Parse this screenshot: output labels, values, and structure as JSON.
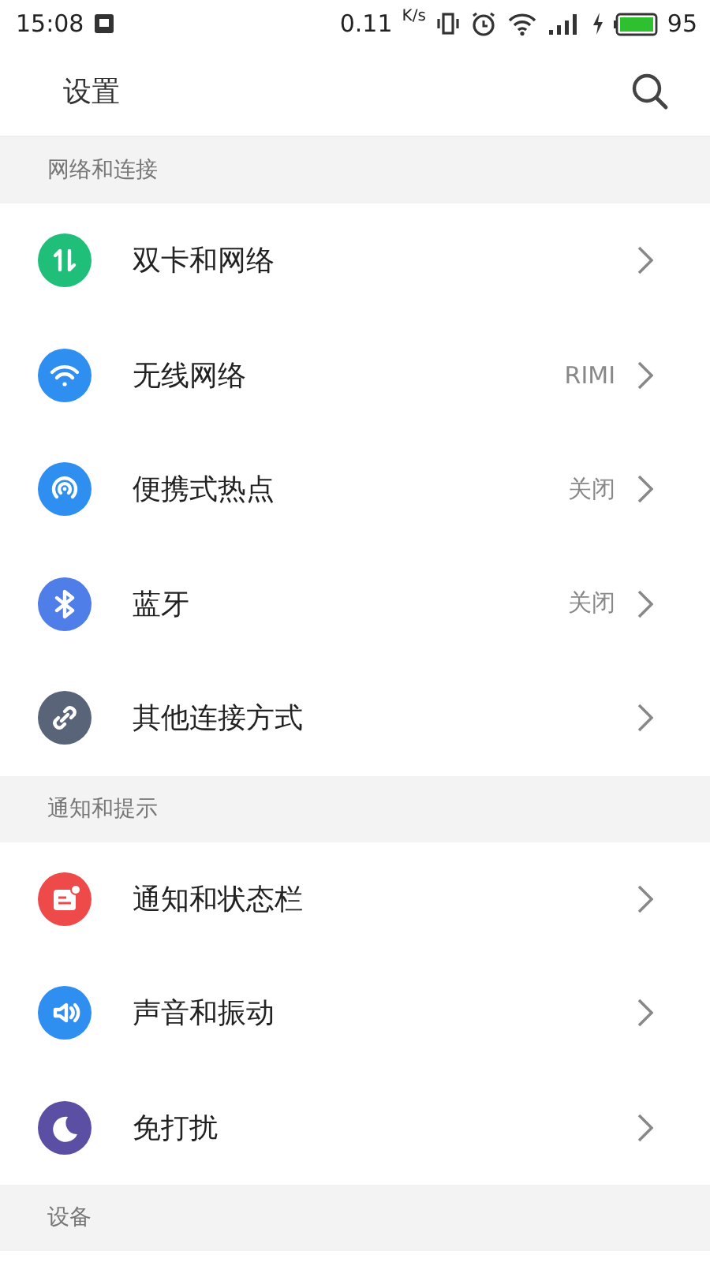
{
  "status_bar": {
    "time": "15:08",
    "speed": "0.11",
    "speed_unit": "K/s",
    "battery": "95"
  },
  "header": {
    "title": "设置"
  },
  "sections": [
    {
      "title": "网络和连接",
      "items": [
        {
          "kind": "sim",
          "color": "#1fbf7a",
          "label": "双卡和网络"
        },
        {
          "kind": "wifi",
          "color": "#2f8ff0",
          "label": "无线网络",
          "value": "RIMI"
        },
        {
          "kind": "hotspot",
          "color": "#2f8ff0",
          "label": "便携式热点",
          "value": "关闭"
        },
        {
          "kind": "bluetooth",
          "color": "#4f7ee8",
          "label": "蓝牙",
          "value": "关闭"
        },
        {
          "kind": "link",
          "color": "#5a6479",
          "label": "其他连接方式"
        }
      ]
    },
    {
      "title": "通知和提示",
      "items": [
        {
          "kind": "notification",
          "color": "#ef4a4a",
          "label": "通知和状态栏"
        },
        {
          "kind": "sound",
          "color": "#2f8ff0",
          "label": "声音和振动"
        },
        {
          "kind": "moon",
          "color": "#5a4fa3",
          "label": "免打扰"
        }
      ]
    },
    {
      "title": "设备"
    }
  ]
}
